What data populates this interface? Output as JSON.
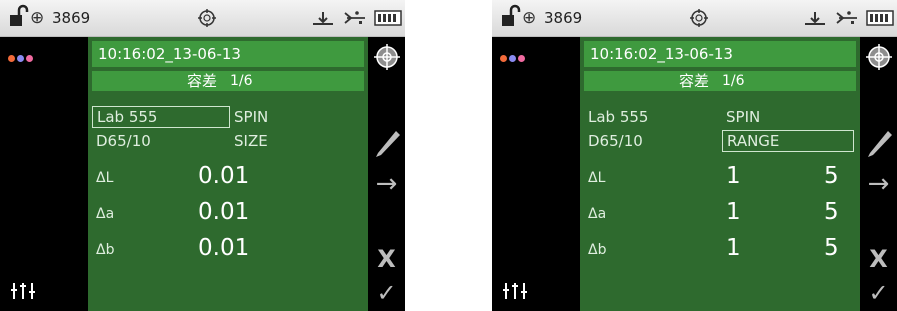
{
  "status": {
    "crosshair_glyph": "⊕",
    "left_count": "3869",
    "right_count": "3869"
  },
  "left": {
    "timestamp": "10:16:02_13-06-13",
    "mode_title": "容差",
    "page": "1/6",
    "row1_left": "Lab 555",
    "row1_right": "SPIN",
    "row2_left": "D65/10",
    "row2_right": "SIZE",
    "deltas": [
      {
        "label": "ΔL",
        "value": "0.01"
      },
      {
        "label": "Δa",
        "value": "0.01"
      },
      {
        "label": "Δb",
        "value": "0.01"
      }
    ]
  },
  "right": {
    "timestamp": "10:16:02_13-06-13",
    "mode_title": "容差",
    "page": "1/6",
    "row1_left": "Lab 555",
    "row1_right": "SPIN",
    "row2_left": "D65/10",
    "row2_right": "RANGE",
    "deltas": [
      {
        "label": "ΔL",
        "lo": "1",
        "hi": "5"
      },
      {
        "label": "Δa",
        "lo": "1",
        "hi": "5"
      },
      {
        "label": "Δb",
        "lo": "1",
        "hi": "5"
      }
    ]
  },
  "side_icons": {
    "arrow_glyph": "→",
    "cancel_glyph": "X",
    "check_glyph": "✓"
  },
  "colors": {
    "panel_green": "#2e6a2e",
    "header_green": "#3f9a3f",
    "dot_colors": [
      "#f26a3a",
      "#8a8af0",
      "#f06aa0"
    ]
  }
}
